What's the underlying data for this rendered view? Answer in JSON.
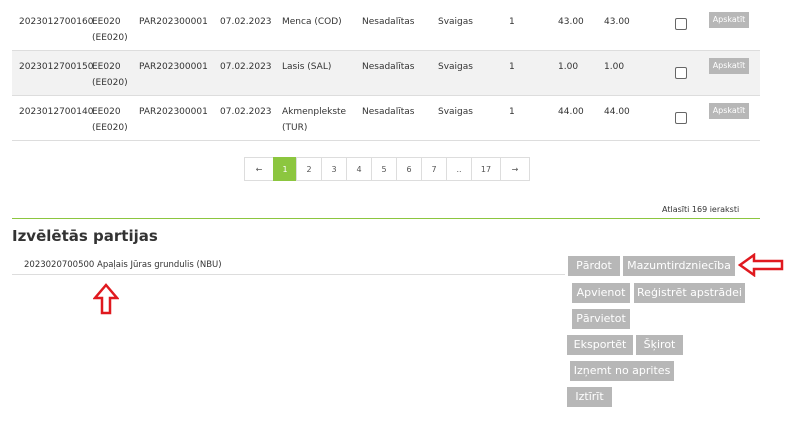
{
  "rows": [
    {
      "id": "2023012700160",
      "code": "EE020 (EE020)",
      "par": "PAR202300001",
      "date": "07.02.2023",
      "species": "Menca (COD)",
      "state": "Nesadalītas",
      "fresh": "Svaigas",
      "qty": "1",
      "w1": "43.00",
      "w2": "43.00",
      "view": "Apskatīt"
    },
    {
      "id": "2023012700150",
      "code": "EE020 (EE020)",
      "par": "PAR202300001",
      "date": "07.02.2023",
      "species": "Lasis (SAL)",
      "state": "Nesadalītas",
      "fresh": "Svaigas",
      "qty": "1",
      "w1": "1.00",
      "w2": "1.00",
      "view": "Apskatīt"
    },
    {
      "id": "2023012700140",
      "code": "EE020 (EE020)",
      "par": "PAR202300001",
      "date": "07.02.2023",
      "species": "Akmenplekste (TUR)",
      "state": "Nesadalītas",
      "fresh": "Svaigas",
      "qty": "1",
      "w1": "44.00",
      "w2": "44.00",
      "view": "Apskatīt"
    }
  ],
  "pagination": {
    "prev": "←",
    "p1": "1",
    "p2": "2",
    "p3": "3",
    "p4": "4",
    "p5": "5",
    "p6": "6",
    "p7": "7",
    "ellipsis": "..",
    "last": "17",
    "next": "→"
  },
  "found_text": "Atlasīti 169 ieraksti",
  "section_title": "Izvēlētās partijas",
  "selected_item": "2023020700500 Apaļais Jūras grundulis (NBU)",
  "actions": {
    "pardot": "Pārdot",
    "mazumtirdznieciba": "Mazumtirdzniecība",
    "apvienot": "Apvienot",
    "registret": "Reģistrēt apstrādei",
    "parvietot": "Pārvietot",
    "eksportet": "Eksportēt",
    "skirot": "Šķirot",
    "iznemt": "Izņemt no aprites",
    "izdzest": "Iztīrīt"
  },
  "colors": {
    "accent": "#8cc63f",
    "button": "#b7b7b7",
    "arrow": "#e0191f"
  },
  "icons": {
    "up_arrow": "up-arrow-icon",
    "left_arrow": "left-arrow-icon"
  }
}
